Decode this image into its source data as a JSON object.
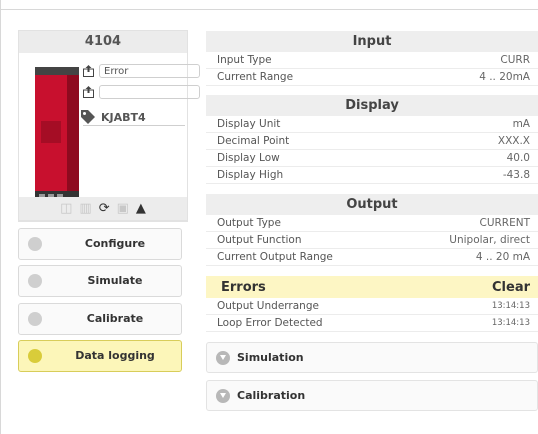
{
  "device": {
    "model": "4104",
    "field1_value": "Error",
    "field2_value": "",
    "tag": "KJABT4"
  },
  "left_buttons": [
    {
      "label": "Configure",
      "active": false
    },
    {
      "label": "Simulate",
      "active": false
    },
    {
      "label": "Calibrate",
      "active": false
    },
    {
      "label": "Data logging",
      "active": true
    }
  ],
  "input": {
    "title": "Input",
    "rows": [
      {
        "label": "Input Type",
        "value": "CURR"
      },
      {
        "label": "Current Range",
        "value": "4 .. 20mA"
      }
    ]
  },
  "display": {
    "title": "Display",
    "rows": [
      {
        "label": "Display Unit",
        "value": "mA"
      },
      {
        "label": "Decimal Point",
        "value": "XXX.X"
      },
      {
        "label": "Display Low",
        "value": "40.0"
      },
      {
        "label": "Display High",
        "value": "-43.8"
      }
    ]
  },
  "output": {
    "title": "Output",
    "rows": [
      {
        "label": "Output Type",
        "value": "CURRENT"
      },
      {
        "label": "Output Function",
        "value": "Unipolar, direct"
      },
      {
        "label": "Current Output Range",
        "value": "4 .. 20 mA"
      }
    ]
  },
  "errors": {
    "title": "Errors",
    "clear_label": "Clear",
    "rows": [
      {
        "label": "Output Underrange",
        "value": "13:14:13"
      },
      {
        "label": "Loop Error Detected",
        "value": "13:14:13"
      }
    ]
  },
  "accordions": [
    {
      "label": "Simulation"
    },
    {
      "label": "Calibration"
    }
  ],
  "colors": {
    "accent_yellow": "#fcf6b9",
    "device_red": "#c8102e"
  },
  "icons": [
    "upload-icon",
    "tag-icon",
    "book-icon",
    "columns-icon",
    "sync-icon",
    "lock-icon",
    "warning-icon",
    "chevron-down-icon"
  ]
}
